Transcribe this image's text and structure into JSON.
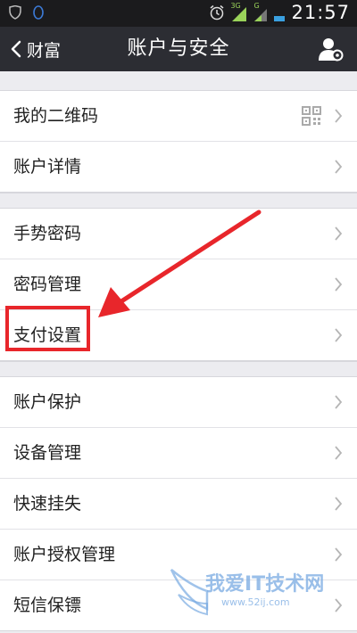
{
  "status_bar": {
    "time": "21:57",
    "network_3g": "3G",
    "network_g": "G",
    "icons": [
      "shield-icon",
      "qq-icon",
      "alarm-icon",
      "signal-3g-icon",
      "signal-g-icon",
      "battery-icon"
    ]
  },
  "nav": {
    "back_label": "财富",
    "title": "账户与安全",
    "action_icon": "user-settings-icon"
  },
  "groups": [
    {
      "items": [
        {
          "label": "我的二维码",
          "icon": "qr-code-icon"
        },
        {
          "label": "账户详情"
        }
      ]
    },
    {
      "items": [
        {
          "label": "手势密码"
        },
        {
          "label": "密码管理"
        },
        {
          "label": "支付设置"
        }
      ]
    },
    {
      "items": [
        {
          "label": "账户保护"
        },
        {
          "label": "设备管理"
        },
        {
          "label": "快速挂失"
        },
        {
          "label": "账户授权管理"
        },
        {
          "label": "短信保镖"
        }
      ]
    }
  ],
  "annotation": {
    "highlight_color": "#e8262b"
  },
  "watermark": {
    "title": "我爱IT技术网",
    "url": "www.52ij.com"
  },
  "colors": {
    "status_bar_bg": "#1b1b1d",
    "nav_bg": "#2c2d33",
    "page_bg": "#ececf0"
  }
}
